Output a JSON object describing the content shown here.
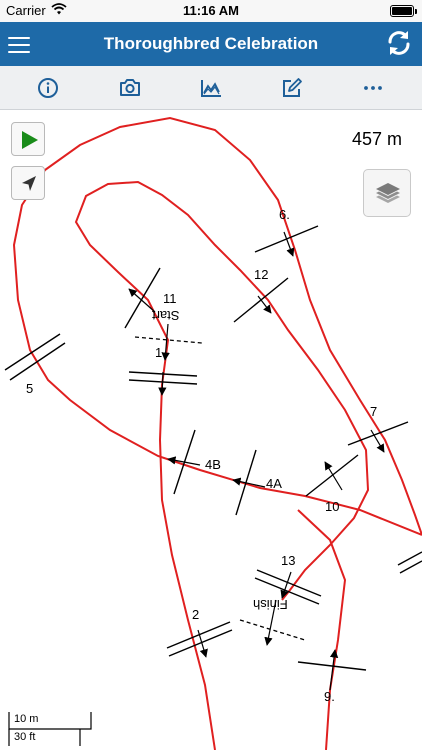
{
  "status": {
    "carrier": "Carrier",
    "time": "11:16 AM",
    "battery_level": 1.0
  },
  "nav": {
    "title": "Thoroughbred Celebration",
    "left_icon": "hamburger-menu-icon",
    "right_icon": "sync-icon"
  },
  "toolbar": {
    "items": [
      "info-icon",
      "camera-icon",
      "chart-icon",
      "edit-icon",
      "more-icon"
    ]
  },
  "map": {
    "distance": "457 m",
    "track_color": "#e02020",
    "play_color": "#1a8c1a",
    "controls": [
      "play-icon",
      "location-arrow-icon",
      "layers-icon"
    ],
    "markers": {
      "m6": "6.",
      "m12": "12",
      "m11": "11",
      "start": "Start",
      "m1": "1",
      "m5": "5",
      "m7": "7",
      "m4b": "4B",
      "m4a": "4A",
      "m10": "10",
      "m13": "13",
      "finish": "Finish",
      "m2": "2",
      "m9": "9."
    },
    "scale": {
      "meters": "10 m",
      "feet": "30 ft"
    }
  }
}
